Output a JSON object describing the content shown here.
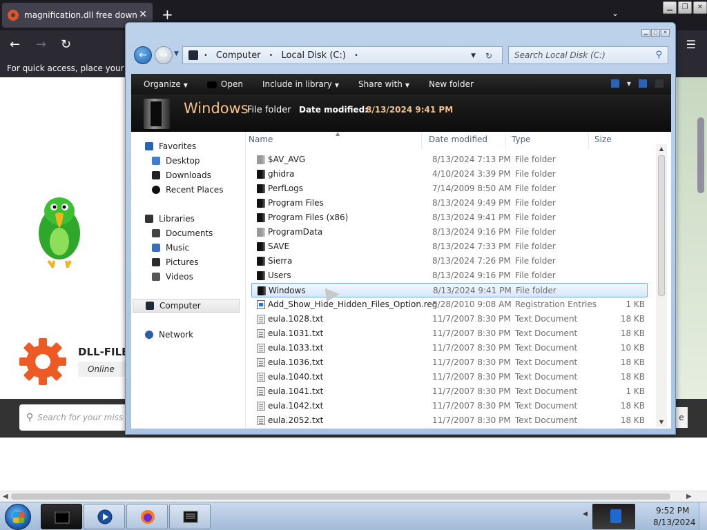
{
  "browser": {
    "tab_title": "magnification.dll free download",
    "tab_close": "✕",
    "new_tab": "+",
    "tab_list": "⌄",
    "back": "←",
    "forward": "→",
    "reload": "↻",
    "menu": "☰",
    "quick_access": "For quick access, place your boo",
    "window_controls": [
      "▁",
      "❐",
      "✕"
    ]
  },
  "webpage": {
    "dll_title": "DLL-FILE",
    "dll_sub": "Online sin",
    "search_placeholder": "Search for your miss",
    "search_btn": "e"
  },
  "explorer": {
    "title_controls": [
      "▁",
      "▢",
      "✕"
    ],
    "address": {
      "crumbs": [
        "Computer",
        "Local Disk (C:)"
      ],
      "sep": "•",
      "dropdown": "▼",
      "refresh": "↻"
    },
    "search_placeholder": "Search Local Disk (C:)",
    "toolbar": {
      "organize": "Organize",
      "open": "Open",
      "include": "Include in library",
      "share": "Share with",
      "new_folder": "New folder",
      "caret": "▼"
    },
    "details": {
      "name": "Windows",
      "type": "File folder",
      "date_label": "Date modified:",
      "date_value": "8/13/2024 9:41 PM"
    },
    "nav": {
      "favorites": "Favorites",
      "desktop": "Desktop",
      "downloads": "Downloads",
      "recent": "Recent Places",
      "libraries": "Libraries",
      "documents": "Documents",
      "music": "Music",
      "pictures": "Pictures",
      "videos": "Videos",
      "computer": "Computer",
      "network": "Network"
    },
    "columns": {
      "name": "Name",
      "date": "Date modified",
      "type": "Type",
      "size": "Size"
    },
    "files": [
      {
        "name": "$AV_AVG",
        "date": "8/13/2024 7:13 PM",
        "type": "File folder",
        "size": ""
      },
      {
        "name": "ghidra",
        "date": "4/10/2024 3:39 PM",
        "type": "File folder",
        "size": ""
      },
      {
        "name": "PerfLogs",
        "date": "7/14/2009 8:50 AM",
        "type": "File folder",
        "size": ""
      },
      {
        "name": "Program Files",
        "date": "8/13/2024 9:49 PM",
        "type": "File folder",
        "size": ""
      },
      {
        "name": "Program Files (x86)",
        "date": "8/13/2024 9:41 PM",
        "type": "File folder",
        "size": ""
      },
      {
        "name": "ProgramData",
        "date": "8/13/2024 9:16 PM",
        "type": "File folder",
        "size": ""
      },
      {
        "name": "SAVE",
        "date": "8/13/2024 7:33 PM",
        "type": "File folder",
        "size": ""
      },
      {
        "name": "Sierra",
        "date": "8/13/2024 7:26 PM",
        "type": "File folder",
        "size": ""
      },
      {
        "name": "Users",
        "date": "8/13/2024 9:16 PM",
        "type": "File folder",
        "size": ""
      },
      {
        "name": "Windows",
        "date": "8/13/2024 9:41 PM",
        "type": "File folder",
        "size": ""
      },
      {
        "name": "Add_Show_Hide_Hidden_Files_Option.reg",
        "date": "5/28/2010 9:08 AM",
        "type": "Registration Entries",
        "size": "1 KB"
      },
      {
        "name": "eula.1028.txt",
        "date": "11/7/2007 8:30 PM",
        "type": "Text Document",
        "size": "18 KB"
      },
      {
        "name": "eula.1031.txt",
        "date": "11/7/2007 8:30 PM",
        "type": "Text Document",
        "size": "18 KB"
      },
      {
        "name": "eula.1033.txt",
        "date": "11/7/2007 8:30 PM",
        "type": "Text Document",
        "size": "10 KB"
      },
      {
        "name": "eula.1036.txt",
        "date": "11/7/2007 8:30 PM",
        "type": "Text Document",
        "size": "18 KB"
      },
      {
        "name": "eula.1040.txt",
        "date": "11/7/2007 8:30 PM",
        "type": "Text Document",
        "size": "18 KB"
      },
      {
        "name": "eula.1041.txt",
        "date": "11/7/2007 8:30 PM",
        "type": "Text Document",
        "size": "1 KB"
      },
      {
        "name": "eula.1042.txt",
        "date": "11/7/2007 8:30 PM",
        "type": "Text Document",
        "size": "18 KB"
      },
      {
        "name": "eula.2052.txt",
        "date": "11/7/2007 8:30 PM",
        "type": "Text Document",
        "size": "18 KB"
      }
    ]
  },
  "taskbar": {
    "time": "9:52 PM",
    "date": "8/13/2024",
    "tray_show": "◀"
  }
}
